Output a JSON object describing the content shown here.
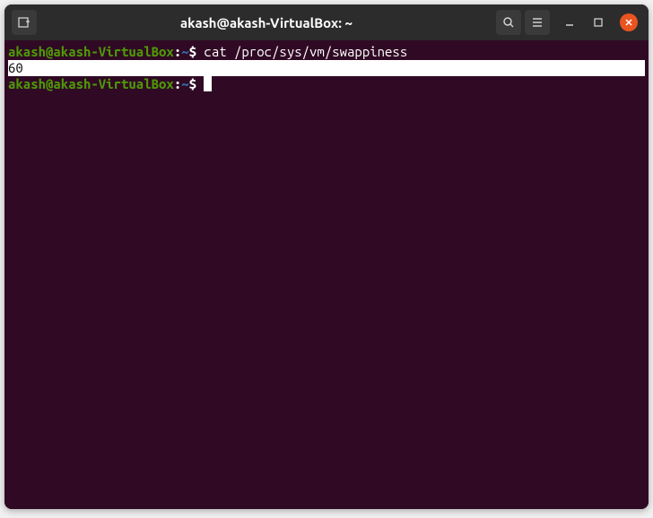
{
  "titlebar": {
    "title": "akash@akash-VirtualBox: ~"
  },
  "terminal": {
    "lines": [
      {
        "user": "akash@akash-VirtualBox",
        "colon": ":",
        "path": "~",
        "symbol": "$",
        "command": " cat /proc/sys/vm/swappiness"
      }
    ],
    "output": "60",
    "prompt2": {
      "user": "akash@akash-VirtualBox",
      "colon": ":",
      "path": "~",
      "symbol": "$",
      "command": " "
    }
  }
}
